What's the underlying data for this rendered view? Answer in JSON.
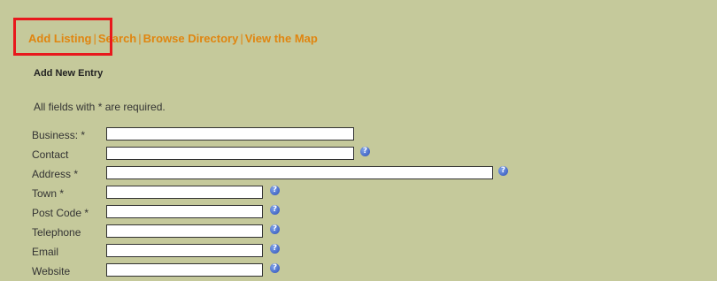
{
  "nav": {
    "add_listing": "Add Listing",
    "search": "Search",
    "browse_directory": "Browse Directory",
    "view_map": "View the Map",
    "separator": "|"
  },
  "page_title": "Add New Entry",
  "required_note": "All fields with * are required.",
  "help_glyph": "?",
  "fields": [
    {
      "label": "Business: *",
      "value": "",
      "help": false
    },
    {
      "label": "Contact",
      "value": "",
      "help": true
    },
    {
      "label": "Address *",
      "value": "",
      "help": true
    },
    {
      "label": "Town *",
      "value": "",
      "help": true
    },
    {
      "label": "Post Code *",
      "value": "",
      "help": true
    },
    {
      "label": "Telephone",
      "value": "",
      "help": true
    },
    {
      "label": "Email",
      "value": "",
      "help": true
    },
    {
      "label": "Website",
      "value": "",
      "help": true
    }
  ],
  "colors": {
    "background": "#c5c99b",
    "nav_link": "#e0850f",
    "highlight": "#e8181c",
    "help_icon": "#2d50b8"
  }
}
